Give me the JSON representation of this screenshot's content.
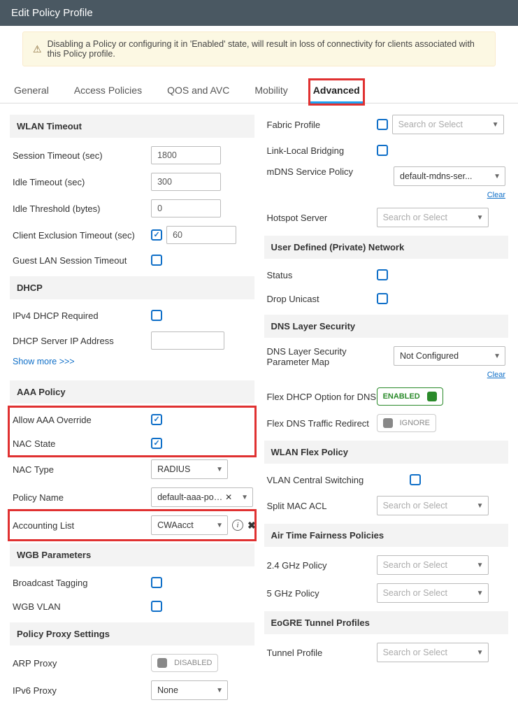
{
  "header": {
    "title": "Edit Policy Profile"
  },
  "warning": "Disabling a Policy or configuring it in 'Enabled' state, will result in loss of connectivity for clients associated with this Policy profile.",
  "tabs": {
    "general": "General",
    "access": "Access Policies",
    "qos": "QOS and AVC",
    "mobility": "Mobility",
    "advanced": "Advanced"
  },
  "left": {
    "wlan_timeout": {
      "header": "WLAN Timeout",
      "session_label": "Session Timeout (sec)",
      "session_val": "1800",
      "idle_label": "Idle Timeout (sec)",
      "idle_val": "300",
      "thresh_label": "Idle Threshold (bytes)",
      "thresh_val": "0",
      "cet_label": "Client Exclusion Timeout (sec)",
      "cet_val": "60",
      "guest_label": "Guest LAN Session Timeout"
    },
    "dhcp": {
      "header": "DHCP",
      "ipv4req_label": "IPv4 DHCP Required",
      "server_label": "DHCP Server IP Address"
    },
    "show_more": "Show more >>>",
    "aaa": {
      "header": "AAA Policy",
      "allow_label": "Allow AAA Override",
      "nac_state_label": "NAC State",
      "nac_type_label": "NAC Type",
      "nac_type_val": "RADIUS",
      "policy_name_label": "Policy Name",
      "policy_name_val": "default-aaa-policy",
      "acct_label": "Accounting List",
      "acct_val": "CWAacct"
    },
    "wgb": {
      "header": "WGB Parameters",
      "broadcast_label": "Broadcast Tagging",
      "vlan_label": "WGB VLAN"
    },
    "proxy": {
      "header": "Policy Proxy Settings",
      "arp_label": "ARP Proxy",
      "arp_val": "DISABLED",
      "ipv6_label": "IPv6 Proxy",
      "ipv6_val": "None"
    }
  },
  "right": {
    "fabric_label": "Fabric Profile",
    "linklocal_label": "Link-Local Bridging",
    "mdns_label": "mDNS Service Policy",
    "mdns_val": "default-mdns-ser...",
    "hotspot_label": "Hotspot Server",
    "udpn": {
      "header": "User Defined (Private) Network",
      "status_label": "Status",
      "drop_label": "Drop Unicast"
    },
    "dns": {
      "header": "DNS Layer Security",
      "param_label": "DNS Layer Security Parameter Map",
      "param_val": "Not Configured",
      "flex_opt_label": "Flex DHCP Option for DNS",
      "flex_opt_val": "ENABLED",
      "flex_red_label": "Flex DNS Traffic Redirect",
      "flex_red_val": "IGNORE"
    },
    "wlanflex": {
      "header": "WLAN Flex Policy",
      "vlan_label": "VLAN Central Switching",
      "split_label": "Split MAC ACL"
    },
    "atf": {
      "header": "Air Time Fairness Policies",
      "g24_label": "2.4 GHz Policy",
      "g5_label": "5 GHz Policy"
    },
    "eogre": {
      "header": "EoGRE Tunnel Profiles",
      "tunnel_label": "Tunnel Profile"
    },
    "placeholder": "Search or Select",
    "clear": "Clear"
  }
}
